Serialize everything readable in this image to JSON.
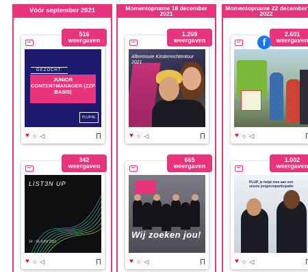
{
  "columns": [
    {
      "header": "Vóór september 2021"
    },
    {
      "header": "Momentopname 18 december 2021"
    },
    {
      "header": "Momentopname 22 december 2022"
    }
  ],
  "posts": [
    {
      "views": "516",
      "unit": "weergaven",
      "image_text": [
        "GEZOCHT:",
        "JUNIOR CONTENTMANAGER (ZZP BASIS)",
        "PLUP.NL"
      ]
    },
    {
      "views": "1.269",
      "unit": "weergaven",
      "image_text": [
        "Aftermovie Kinderrechtentour 2021"
      ]
    },
    {
      "views": "2.601",
      "unit": "weergaven",
      "image_text": []
    },
    {
      "views": "342",
      "unit": "weergaven",
      "image_text": [
        "LIST3N UP",
        "14 - 18 JUNI 2021"
      ]
    },
    {
      "views": "665",
      "unit": "weergaven",
      "image_text": [
        "Wij zoeken jou!"
      ]
    },
    {
      "views": "1.002",
      "unit": "weergaven",
      "image_text": [
        "PLUP, je helpt mee aan een sessie jongerenparticipatie"
      ]
    }
  ],
  "icons": {
    "like": "heart-icon",
    "comment": "comment-icon",
    "share": "send-icon",
    "save": "bookmark-icon",
    "facebook": "facebook-icon",
    "instagram": "instagram-icon"
  },
  "colors": {
    "accent": "#e8337d",
    "facebook": "#1877f2"
  }
}
